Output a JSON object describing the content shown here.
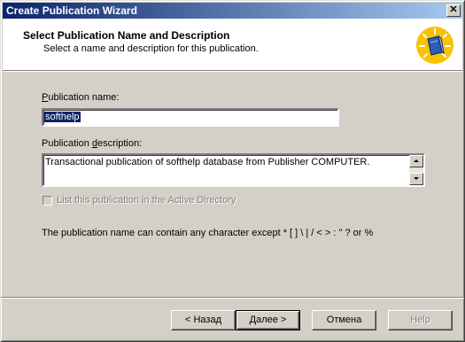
{
  "window": {
    "title": "Create Publication Wizard"
  },
  "header": {
    "title": "Select Publication Name and Description",
    "subtitle": "Select a name and description for this publication."
  },
  "form": {
    "name_label": "Publication name:",
    "name_value": "softhelp",
    "description_label": "Publication description:",
    "description_value": "Transactional publication of softhelp database from Publisher COMPUTER.",
    "active_directory_label": "List this publication in the Active Directory",
    "active_directory_checked": false,
    "hint": "The publication name can contain any character except * [ ] \\ | / < > : \" ? or %"
  },
  "buttons": {
    "back": "< Назад",
    "next": "Далее >",
    "cancel": "Отмена",
    "help": "Help"
  }
}
